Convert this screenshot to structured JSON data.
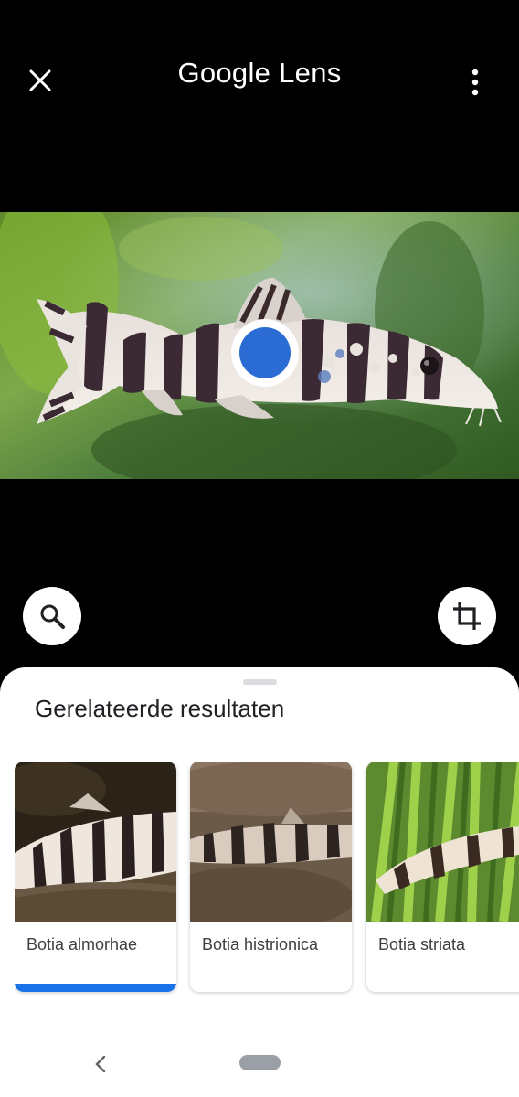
{
  "header": {
    "title": "Google Lens",
    "close_icon": "close-icon",
    "menu_icon": "more-vert-icon"
  },
  "photo": {
    "subject": "striped loach fish",
    "focus_marker_color": "#2b6cd4"
  },
  "actions": {
    "search_icon": "search-icon",
    "crop_icon": "crop-icon"
  },
  "results": {
    "title": "Gerelateerde resultaten",
    "items": [
      {
        "label": "Botia almorhae",
        "selected": true
      },
      {
        "label": "Botia histrionica",
        "selected": false
      },
      {
        "label": "Botia striata",
        "selected": false
      }
    ],
    "selected_color": "#1a73e8"
  },
  "navbar": {
    "back_icon": "nav-back-icon",
    "home_icon": "nav-home-pill"
  }
}
